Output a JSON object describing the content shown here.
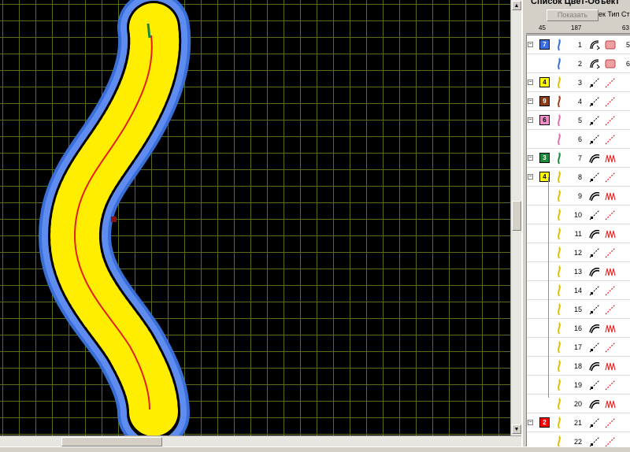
{
  "panel": {
    "title": "Список Цвет-Объект",
    "show_button": "Показать",
    "column_heads": "ек Тип Сте",
    "ruler": [
      "45",
      "187",
      "63"
    ]
  },
  "rows": [
    {
      "num": "1",
      "group": true,
      "color_label": "7",
      "color": "#3a6fe0",
      "text_color": "#ffffff",
      "type": "applique",
      "stitch": "fill",
      "tail": "5"
    },
    {
      "num": "2",
      "group": false,
      "color_label": "",
      "color": "",
      "type": "applique",
      "stitch": "fill",
      "tail": "6"
    },
    {
      "num": "3",
      "group": true,
      "color_label": "4",
      "color": "#ffff00",
      "text_color": "#000000",
      "type": "running",
      "stitch": "line",
      "tail": ""
    },
    {
      "num": "4",
      "group": true,
      "color_label": "9",
      "color": "#8b3a0f",
      "text_color": "#ffffff",
      "type": "running",
      "stitch": "line",
      "tail": ""
    },
    {
      "num": "5",
      "group": true,
      "color_label": "6",
      "color": "#f08cc8",
      "text_color": "#000000",
      "type": "running",
      "stitch": "line",
      "tail": ""
    },
    {
      "num": "6",
      "group": false,
      "color_label": "",
      "color": "",
      "type": "running",
      "stitch": "line",
      "tail": ""
    },
    {
      "num": "7",
      "group": true,
      "color_label": "3",
      "color": "#1a8a3a",
      "text_color": "#ffffff",
      "type": "satin",
      "stitch": "zigzag",
      "tail": ""
    },
    {
      "num": "8",
      "group": true,
      "color_label": "4",
      "color": "#ffff00",
      "text_color": "#000000",
      "type": "running",
      "stitch": "line",
      "tail": ""
    },
    {
      "num": "9",
      "group": false,
      "color_label": "",
      "color": "",
      "type": "satin",
      "stitch": "zigzag",
      "tail": ""
    },
    {
      "num": "10",
      "group": false,
      "color_label": "",
      "color": "",
      "type": "running",
      "stitch": "line",
      "tail": ""
    },
    {
      "num": "11",
      "group": false,
      "color_label": "",
      "color": "",
      "type": "satin",
      "stitch": "zigzag",
      "tail": ""
    },
    {
      "num": "12",
      "group": false,
      "color_label": "",
      "color": "",
      "type": "running",
      "stitch": "line",
      "tail": ""
    },
    {
      "num": "13",
      "group": false,
      "color_label": "",
      "color": "",
      "type": "satin",
      "stitch": "zigzag",
      "tail": ""
    },
    {
      "num": "14",
      "group": false,
      "color_label": "",
      "color": "",
      "type": "running",
      "stitch": "line",
      "tail": ""
    },
    {
      "num": "15",
      "group": false,
      "color_label": "",
      "color": "",
      "type": "running",
      "stitch": "line",
      "tail": ""
    },
    {
      "num": "16",
      "group": false,
      "color_label": "",
      "color": "",
      "type": "satin",
      "stitch": "zigzag",
      "tail": ""
    },
    {
      "num": "17",
      "group": false,
      "color_label": "",
      "color": "",
      "type": "running",
      "stitch": "line",
      "tail": ""
    },
    {
      "num": "18",
      "group": false,
      "color_label": "",
      "color": "",
      "type": "satin",
      "stitch": "zigzag",
      "tail": ""
    },
    {
      "num": "19",
      "group": false,
      "color_label": "",
      "color": "",
      "type": "running",
      "stitch": "line",
      "tail": ""
    },
    {
      "num": "20",
      "group": false,
      "color_label": "",
      "color": "",
      "type": "satin",
      "stitch": "zigzag",
      "tail": ""
    },
    {
      "num": "21",
      "group": true,
      "color_label": "2",
      "color": "#ff0000",
      "text_color": "#ffffff",
      "type": "running",
      "stitch": "line",
      "tail": ""
    },
    {
      "num": "22",
      "group": false,
      "color_label": "",
      "color": "",
      "type": "running",
      "stitch": "line",
      "tail": ""
    }
  ],
  "colors": {
    "outline": "#3a6fd8",
    "fill": "#ffee00",
    "center": "#e02020",
    "grid": "#5a6b1a",
    "accent_green": "#1a8a3a"
  }
}
